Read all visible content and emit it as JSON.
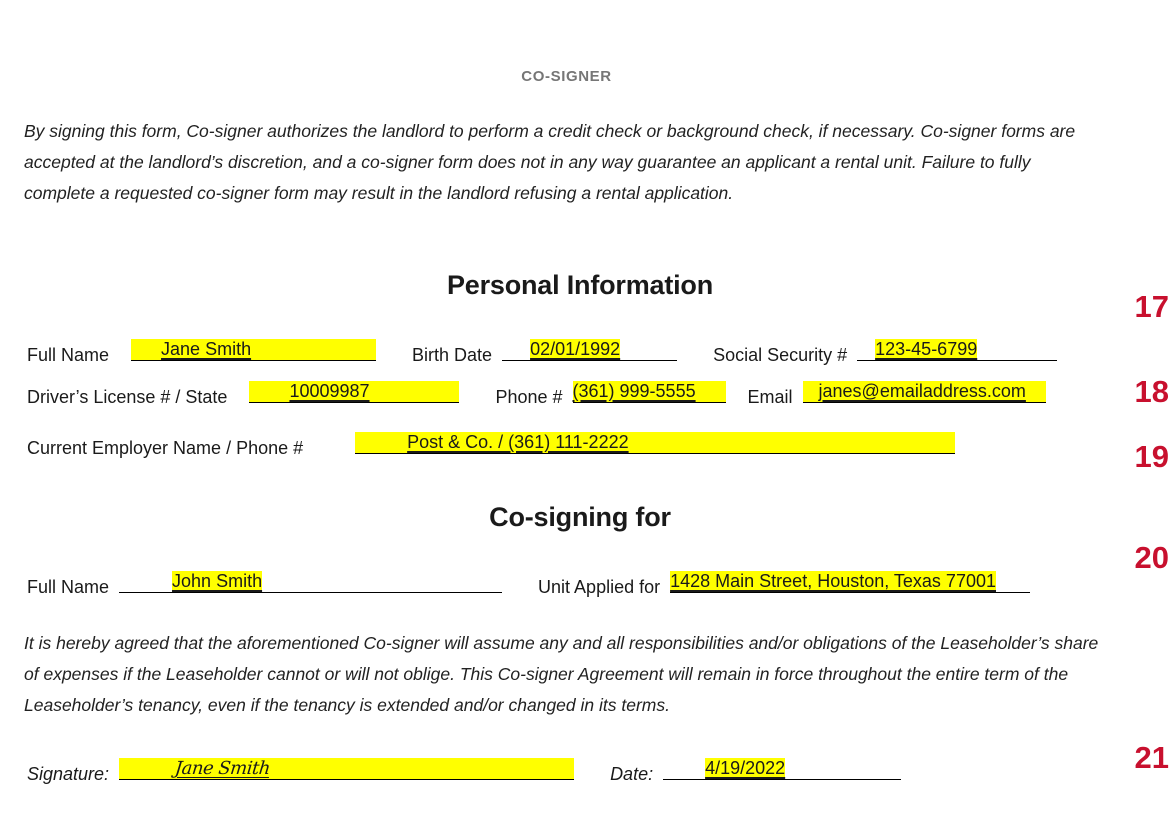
{
  "document": {
    "header": "CO-SIGNER",
    "intro_paragraph": "By signing this form, Co-signer authorizes the landlord to perform a credit check or background check, if necessary. Co-signer forms are accepted at the landlord’s discretion, and a co-signer form does not in any way guarantee an applicant a rental unit. Failure to fully complete a requested co-signer form may result in the landlord refusing a rental application.",
    "agreement_paragraph": "It is hereby agreed that the aforementioned Co-signer will assume any and all responsibilities and/or obligations of the Leaseholder’s share of expenses if the Leaseholder cannot or will not oblige. This Co-signer Agreement will remain in force throughout the entire term of the Leaseholder’s tenancy, even if the tenancy is extended and/or changed in its terms."
  },
  "sections": {
    "personal_information": {
      "heading": "Personal Information",
      "fields": {
        "full_name": {
          "label": "Full Name",
          "value": "Jane Smith"
        },
        "birth_date": {
          "label": "Birth Date",
          "value": "02/01/1992"
        },
        "social_security": {
          "label": "Social Security #",
          "value": "123-45-6799"
        },
        "drivers_license": {
          "label": "Driver’s License # / State",
          "value": "10009987"
        },
        "phone": {
          "label": "Phone #",
          "value": "(361) 999-5555"
        },
        "email": {
          "label": "Email",
          "value": "janes@emailaddress.com"
        },
        "employer": {
          "label": "Current Employer Name / Phone #",
          "value": "Post & Co. / (361) 111-2222"
        }
      }
    },
    "co_signing_for": {
      "heading": "Co-signing for",
      "fields": {
        "full_name": {
          "label": "Full Name",
          "value": "John Smith"
        },
        "unit_applied_for": {
          "label": "Unit Applied for",
          "value": "1428 Main Street, Houston, Texas 77001"
        }
      }
    },
    "signature_block": {
      "signature": {
        "label": "Signature:",
        "value": "Jane Smith"
      },
      "date": {
        "label": "Date:",
        "value": "4/19/2022"
      }
    }
  },
  "margin_numbers": [
    "17",
    "18",
    "19",
    "20",
    "21"
  ],
  "colors": {
    "highlight": "#FFFF00",
    "margin_number": "#C8102E",
    "header_text": "#767676",
    "body_text": "#1A1A1A"
  }
}
